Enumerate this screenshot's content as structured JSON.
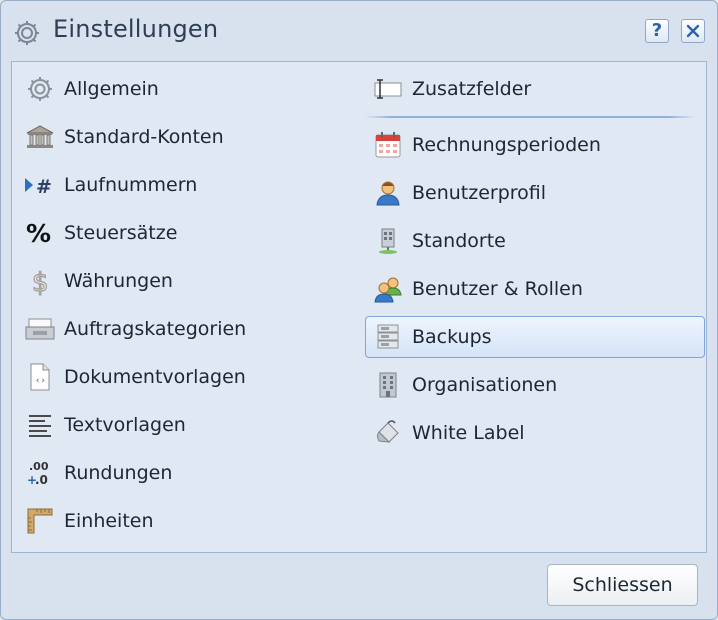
{
  "dialog": {
    "title": "Einstellungen",
    "title_icon": "gear-icon",
    "help_label": "?",
    "close_label": "×"
  },
  "left_items": [
    {
      "label": "Allgemein",
      "icon": "gear-icon"
    },
    {
      "label": "Standard-Konten",
      "icon": "bank-icon"
    },
    {
      "label": "Laufnummern",
      "icon": "number-sequence-icon"
    },
    {
      "label": "Steuersätze",
      "icon": "percent-icon"
    },
    {
      "label": "Währungen",
      "icon": "dollar-icon"
    },
    {
      "label": "Auftragskategorien",
      "icon": "tray-icon"
    },
    {
      "label": "Dokumentvorlagen",
      "icon": "document-template-icon"
    },
    {
      "label": "Textvorlagen",
      "icon": "text-lines-icon"
    },
    {
      "label": "Rundungen",
      "icon": "rounding-icon"
    },
    {
      "label": "Einheiten",
      "icon": "ruler-icon"
    }
  ],
  "right_items": [
    {
      "label": "Zusatzfelder",
      "icon": "text-field-icon"
    },
    {
      "label": "Rechnungsperioden",
      "icon": "calendar-icon"
    },
    {
      "label": "Benutzerprofil",
      "icon": "user-icon"
    },
    {
      "label": "Standorte",
      "icon": "location-building-icon"
    },
    {
      "label": "Benutzer & Rollen",
      "icon": "users-icon"
    },
    {
      "label": "Backups",
      "icon": "database-icon",
      "selected": true
    },
    {
      "label": "Organisationen",
      "icon": "office-building-icon"
    },
    {
      "label": "White Label",
      "icon": "paint-bucket-icon"
    }
  ],
  "footer": {
    "close_button_label": "Schliessen"
  }
}
